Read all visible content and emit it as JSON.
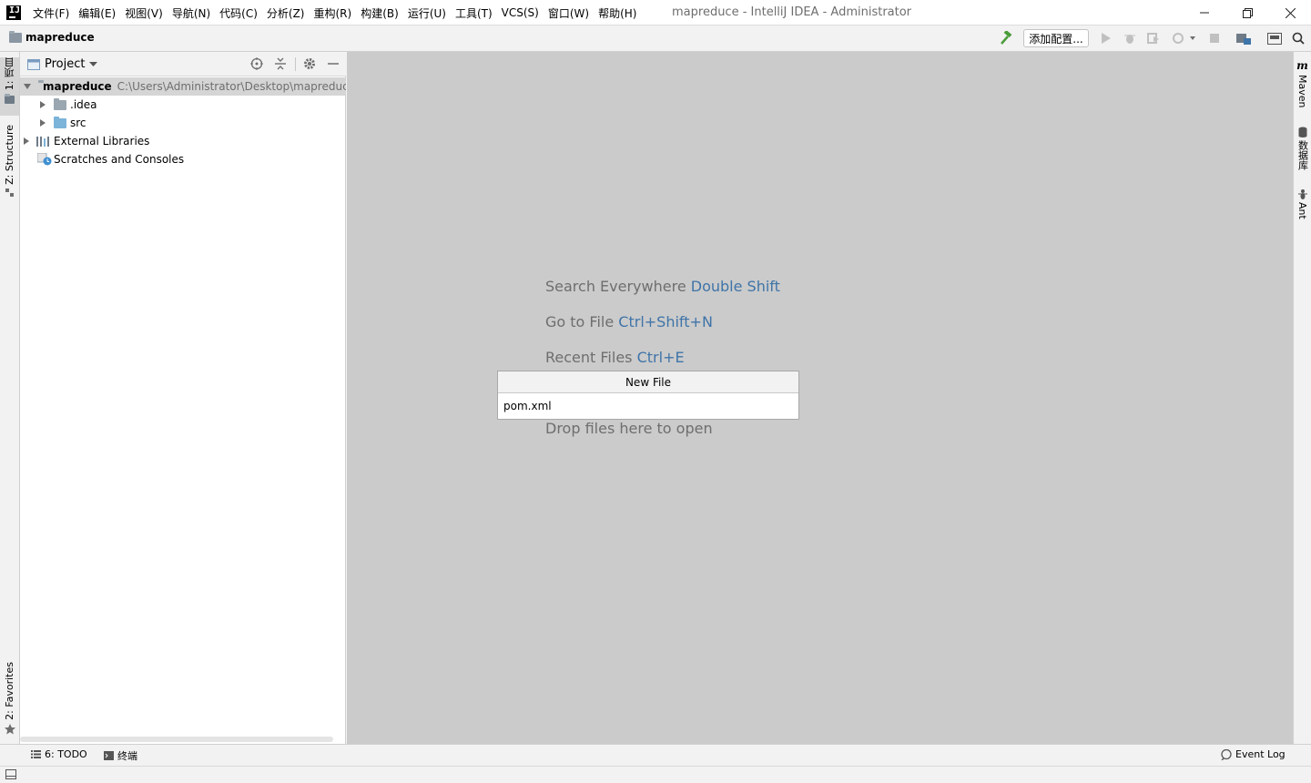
{
  "window": {
    "title": "mapreduce - IntelliJ IDEA - Administrator",
    "logo": "IJ"
  },
  "menu": [
    "文件(F)",
    "编辑(E)",
    "视图(V)",
    "导航(N)",
    "代码(C)",
    "分析(Z)",
    "重构(R)",
    "构建(B)",
    "运行(U)",
    "工具(T)",
    "VCS(S)",
    "窗口(W)",
    "帮助(H)"
  ],
  "navbar": {
    "project": "mapreduce",
    "add_config": "添加配置..."
  },
  "left_stripe": {
    "project_tab": "1: 项目",
    "structure_tab": "Z: Structure",
    "favorites_tab": "2: Favorites"
  },
  "project_panel": {
    "title": "Project",
    "tree": [
      {
        "name": "mapreduce",
        "path": "C:\\Users\\Administrator\\Desktop\\mapreduce"
      },
      {
        "name": ".idea"
      },
      {
        "name": "src"
      },
      {
        "name": "External Libraries"
      },
      {
        "name": "Scratches and Consoles"
      }
    ]
  },
  "editor": {
    "hints": [
      {
        "text": "Search Everywhere",
        "key": "Double Shift"
      },
      {
        "text": "Go to File",
        "key": "Ctrl+Shift+N"
      },
      {
        "text": "Recent Files",
        "key": "Ctrl+E"
      }
    ],
    "drop": "Drop files here to open"
  },
  "new_file_popup": {
    "title": "New File",
    "value": "pom.xml"
  },
  "right_stripe": {
    "maven": "Maven",
    "database": "数据库",
    "ant": "Ant"
  },
  "bottom_bar": {
    "todo": "6: TODO",
    "terminal": "终端",
    "event_log": "Event Log"
  },
  "colors": {
    "editor_bg": "#cbcbcb",
    "hint_key": "#3f74a8",
    "hint_text": "#6e6e6e",
    "build_icon": "#4a9c3a"
  }
}
